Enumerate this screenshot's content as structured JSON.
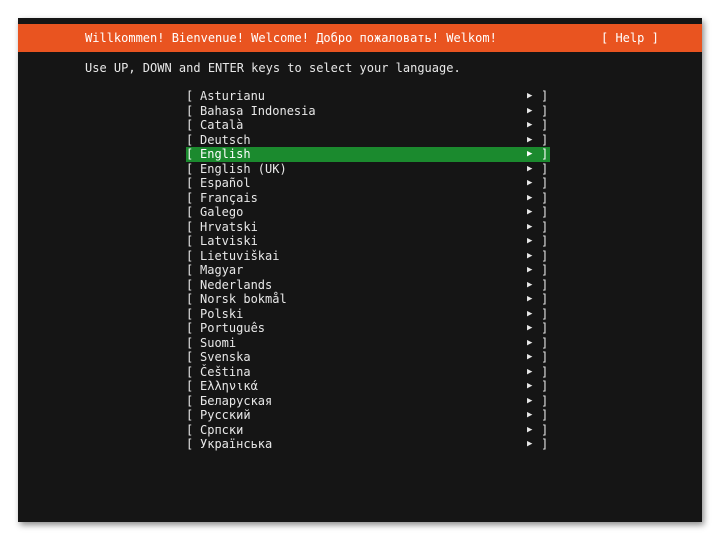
{
  "header": {
    "title": "Willkommen! Bienvenue! Welcome! Добро пожаловать! Welkom!",
    "help_label": "[ Help ]"
  },
  "instructions": "Use UP, DOWN and ENTER keys to select your language.",
  "bracket_left": "[",
  "bracket_right": "]",
  "arrow_glyph": "▶",
  "languages": [
    {
      "label": "Asturianu",
      "selected": false
    },
    {
      "label": "Bahasa Indonesia",
      "selected": false
    },
    {
      "label": "Català",
      "selected": false
    },
    {
      "label": "Deutsch",
      "selected": false
    },
    {
      "label": "English",
      "selected": true
    },
    {
      "label": "English (UK)",
      "selected": false
    },
    {
      "label": "Español",
      "selected": false
    },
    {
      "label": "Français",
      "selected": false
    },
    {
      "label": "Galego",
      "selected": false
    },
    {
      "label": "Hrvatski",
      "selected": false
    },
    {
      "label": "Latviski",
      "selected": false
    },
    {
      "label": "Lietuviškai",
      "selected": false
    },
    {
      "label": "Magyar",
      "selected": false
    },
    {
      "label": "Nederlands",
      "selected": false
    },
    {
      "label": "Norsk bokmål",
      "selected": false
    },
    {
      "label": "Polski",
      "selected": false
    },
    {
      "label": "Português",
      "selected": false
    },
    {
      "label": "Suomi",
      "selected": false
    },
    {
      "label": "Svenska",
      "selected": false
    },
    {
      "label": "Čeština",
      "selected": false
    },
    {
      "label": "Ελληνικά",
      "selected": false
    },
    {
      "label": "Беларуская",
      "selected": false
    },
    {
      "label": "Русский",
      "selected": false
    },
    {
      "label": "Српски",
      "selected": false
    },
    {
      "label": "Українська",
      "selected": false
    }
  ],
  "colors": {
    "header_bg": "#e95420",
    "screen_bg": "#151515",
    "selected_bg": "#1b8a2e",
    "text": "#e8e8e8"
  }
}
